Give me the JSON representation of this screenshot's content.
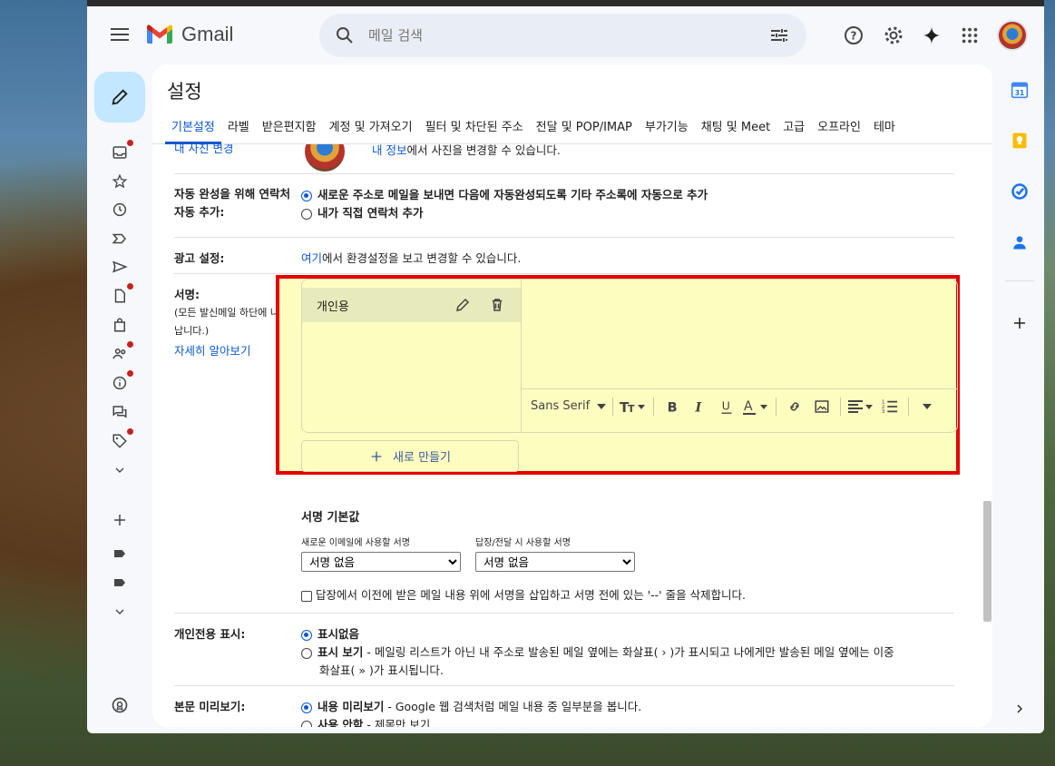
{
  "app": {
    "name": "Gmail"
  },
  "search": {
    "placeholder": "메일 검색"
  },
  "settings": {
    "title": "설정",
    "tabs": [
      "기본설정",
      "라벨",
      "받은편지함",
      "계정 및 가져오기",
      "필터 및 차단된 주소",
      "전달 및 POP/IMAP",
      "부가기능",
      "채팅 및 Meet",
      "고급",
      "오프라인",
      "테마"
    ],
    "active_tab": 0
  },
  "profile_row": {
    "truncated_label": "내 사진 변경",
    "text_link": "내 정보",
    "text_rest": "에서 사진을 변경할 수 있습니다."
  },
  "autocomplete": {
    "label_line1": "자동 완성을 위해 연락처",
    "label_line2": "자동 추가:",
    "option1": "새로운 주소로 메일을 보내면 다음에 자동완성되도록 기타 주소록에 자동으로 추가",
    "option2": "내가 직접 연락처 추가"
  },
  "ads": {
    "label": "광고 설정:",
    "link": "여기",
    "rest": "에서 환경설정을 보고 변경할 수 있습니다."
  },
  "signature": {
    "label": "서명:",
    "sub_line1": "(모든 발신메일 하단에 나타",
    "sub_line2": "납니다.)",
    "learn_more": "자세히 알아보기",
    "items": [
      "개인용"
    ],
    "font": "Sans Serif",
    "new_button": "새로 만들기",
    "defaults_title": "서명 기본값",
    "new_email_label": "새로운 이메일에 사용할 서명",
    "reply_label": "답장/전달 시 사용할 서명",
    "new_email_value": "서명 없음",
    "reply_value": "서명 없음",
    "insert_checkbox": "답장에서 이전에 받은 메일 내용 위에 서명을 삽입하고 서명 전에 있는 '--' 줄을 삭제합니다."
  },
  "personal_indicator": {
    "label": "개인전용 표시:",
    "option1": "표시없음",
    "option2_bold": "표시 보기",
    "option2_rest": " - 메일링 리스트가 아닌 내 주소로 발송된 메일 옆에는 화살표( › )가 표시되고 나에게만 발송된 메일 옆에는 이중",
    "option2_line2": "화살표( » )가 표시됩니다."
  },
  "preview": {
    "label": "본문 미리보기:",
    "option1_bold": "내용 미리보기",
    "option1_rest": " - Google 웹 검색처럼 메일 내용 중 일부분을 봅니다.",
    "option2_bold": "사용 안함",
    "option2_rest": " - 제목만 보기"
  },
  "colors": {
    "accent": "#0b57d0",
    "highlight": "#fdfdc0",
    "highlight_border": "#e60000"
  }
}
